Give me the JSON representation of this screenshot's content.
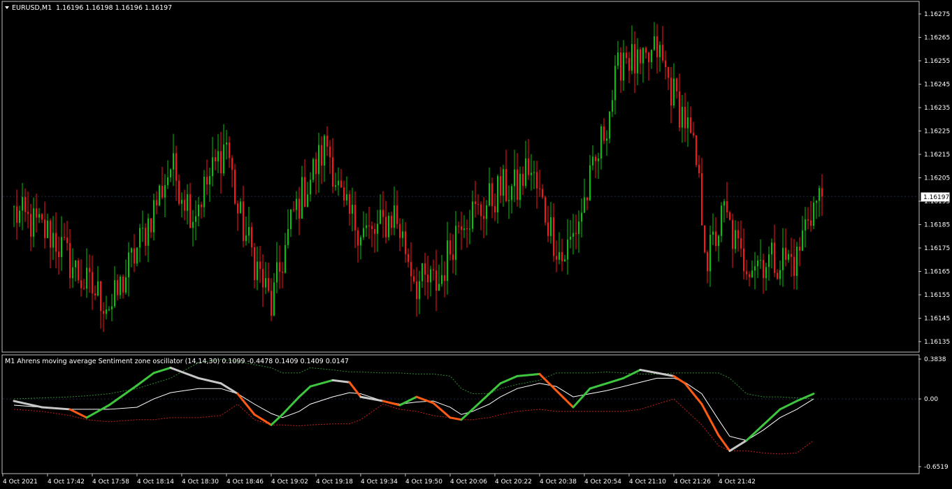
{
  "window": {
    "title": "EURUSD,M1",
    "ohlc": "1.16196 1.16198 1.16196 1.16197"
  },
  "colors": {
    "background": "#000000",
    "bull": "#00c800",
    "bear": "#ff1414",
    "axis": "#c0c0c0",
    "grid": "#1e2a44",
    "osc_green": "#3ec63e",
    "osc_orange": "#ff5a14",
    "osc_gray": "#c8c8c8",
    "osc_signal": "#ffffff",
    "band_green": "#2e8b2e",
    "band_red": "#c81e1e"
  },
  "price_axis": {
    "ticks": [
      "1.16275",
      "1.16265",
      "1.16255",
      "1.16245",
      "1.16235",
      "1.16225",
      "1.16215",
      "1.16205",
      "1.16195",
      "1.16185",
      "1.16175",
      "1.16165",
      "1.16155",
      "1.16145",
      "1.16135"
    ],
    "current_price": "1.16197"
  },
  "time_axis": {
    "labels": [
      "4 Oct 2021",
      "4 Oct 17:42",
      "4 Oct 17:58",
      "4 Oct 18:14",
      "4 Oct 18:30",
      "4 Oct 18:46",
      "4 Oct 19:02",
      "4 Oct 19:18",
      "4 Oct 19:34",
      "4 Oct 19:50",
      "4 Oct 20:06",
      "4 Oct 20:22",
      "4 Oct 20:38",
      "4 Oct 20:54",
      "4 Oct 21:10",
      "4 Oct 21:26",
      "4 Oct 21:42"
    ]
  },
  "indicator": {
    "header": "M1 Ahrens moving average Sentiment zone oscillator (14,14,30) 0.1099 -0.4478 0.1409 0.1409 0.0147",
    "ticks": [
      "0.3838",
      "0.00",
      "-0.6519"
    ]
  },
  "chart_data": [
    {
      "type": "candlestick",
      "symbol": "EURUSD",
      "timeframe": "M1",
      "ylim": [
        1.1613,
        1.1628
      ],
      "anchors_time": [
        "16:56",
        "17:10",
        "17:21",
        "17:31",
        "17:42",
        "17:52",
        "18:00",
        "18:08",
        "18:12",
        "18:16",
        "18:22",
        "18:28",
        "18:36",
        "18:44",
        "18:48",
        "18:54",
        "19:04",
        "19:12",
        "19:20",
        "19:28",
        "19:36",
        "19:42",
        "19:50",
        "19:56",
        "20:00",
        "20:06",
        "20:12",
        "20:16",
        "20:24",
        "20:30",
        "20:34",
        "20:40",
        "20:46",
        "20:52",
        "20:56",
        "21:00",
        "21:04",
        "21:10",
        "21:16",
        "21:22",
        "21:30",
        "21:36",
        "21:40",
        "21:45"
      ],
      "anchors_close": [
        1.1619,
        1.1618,
        1.1616,
        1.1615,
        1.1618,
        1.1621,
        1.1619,
        1.1621,
        1.16221,
        1.1619,
        1.1617,
        1.1615,
        1.1619,
        1.1621,
        1.1622,
        1.1619,
        1.1618,
        1.1619,
        1.1616,
        1.1616,
        1.1619,
        1.1619,
        1.162,
        1.162,
        1.1621,
        1.1619,
        1.1617,
        1.1618,
        1.1621,
        1.1624,
        1.1626,
        1.1625,
        1.1626,
        1.1624,
        1.1623,
        1.1621,
        1.1617,
        1.1619,
        1.1617,
        1.1617,
        1.1617,
        1.1617,
        1.1619,
        1.16197
      ]
    },
    {
      "type": "line",
      "title": "M1 Ahrens moving average Sentiment zone oscillator (14,14,30)",
      "ylim": [
        -0.6519,
        0.3838
      ],
      "x_time": [
        "16:56",
        "17:06",
        "17:16",
        "17:22",
        "17:30",
        "17:40",
        "17:46",
        "17:52",
        "18:02",
        "18:10",
        "18:16",
        "18:22",
        "18:28",
        "18:32",
        "18:38",
        "18:42",
        "18:50",
        "18:56",
        "19:00",
        "19:08",
        "19:14",
        "19:20",
        "19:26",
        "19:32",
        "19:36",
        "19:40",
        "19:46",
        "19:50",
        "19:56",
        "20:04",
        "20:10",
        "20:16",
        "20:22",
        "20:28",
        "20:34",
        "20:40",
        "20:46",
        "20:52",
        "20:56",
        "21:02",
        "21:08",
        "21:12",
        "21:18",
        "21:24",
        "21:30",
        "21:36",
        "21:42"
      ],
      "series": [
        {
          "values": [
            -0.02,
            -0.08,
            -0.1,
            -0.18,
            -0.06,
            0.13,
            0.25,
            0.3,
            0.2,
            0.15,
            0.05,
            -0.15,
            -0.25,
            -0.15,
            0.02,
            0.12,
            0.18,
            0.16,
            0.02,
            -0.02,
            -0.06,
            0.02,
            -0.04,
            -0.18,
            -0.2,
            -0.1,
            0.05,
            0.15,
            0.22,
            0.24,
            0.08,
            -0.08,
            0.1,
            0.15,
            0.2,
            0.28,
            0.25,
            0.22,
            0.15,
            -0.05,
            -0.35,
            -0.5,
            -0.4,
            -0.25,
            -0.1,
            -0.02,
            0.05
          ]
        },
        {
          "values": [
            -0.06,
            -0.08,
            -0.1,
            -0.1,
            -0.1,
            -0.08,
            0.0,
            0.06,
            0.1,
            0.1,
            0.05,
            -0.05,
            -0.14,
            -0.18,
            -0.12,
            -0.05,
            0.02,
            0.06,
            0.05,
            -0.02,
            -0.05,
            -0.03,
            -0.02,
            -0.08,
            -0.15,
            -0.12,
            -0.05,
            0.02,
            0.1,
            0.15,
            0.12,
            0.02,
            0.05,
            0.08,
            0.12,
            0.16,
            0.2,
            0.2,
            0.16,
            0.05,
            -0.2,
            -0.36,
            -0.4,
            -0.3,
            -0.18,
            -0.1,
            0.0
          ]
        },
        {
          "values": [
            0.0,
            0.01,
            0.02,
            0.03,
            0.05,
            0.1,
            0.15,
            0.2,
            0.35,
            0.38,
            0.36,
            0.33,
            0.3,
            0.25,
            0.25,
            0.3,
            0.28,
            0.26,
            0.26,
            0.25,
            0.25,
            0.24,
            0.24,
            0.22,
            0.1,
            0.05,
            0.05,
            0.1,
            0.14,
            0.18,
            0.25,
            0.25,
            0.25,
            0.26,
            0.25,
            0.24,
            0.24,
            0.25,
            0.25,
            0.25,
            0.25,
            0.2,
            0.05,
            0.02,
            0.02,
            0.01,
            0.0
          ]
        },
        {
          "values": [
            -0.1,
            -0.12,
            -0.16,
            -0.2,
            -0.22,
            -0.2,
            -0.2,
            -0.18,
            -0.18,
            -0.16,
            -0.05,
            -0.2,
            -0.25,
            -0.25,
            -0.26,
            -0.25,
            -0.24,
            -0.24,
            -0.2,
            -0.05,
            -0.1,
            -0.12,
            -0.16,
            -0.18,
            -0.2,
            -0.2,
            -0.18,
            -0.15,
            -0.12,
            -0.1,
            -0.12,
            -0.12,
            -0.12,
            -0.12,
            -0.12,
            -0.1,
            -0.05,
            0.0,
            -0.1,
            -0.25,
            -0.45,
            -0.5,
            -0.5,
            -0.52,
            -0.53,
            -0.52,
            -0.4
          ]
        }
      ]
    }
  ]
}
